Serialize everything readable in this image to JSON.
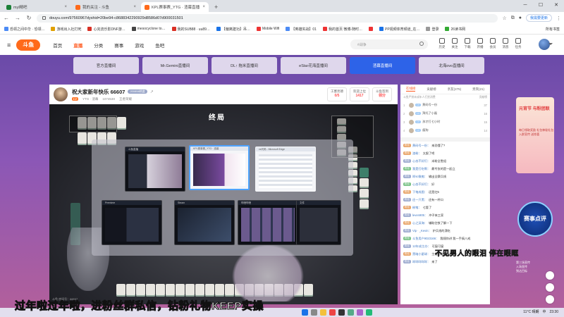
{
  "browser": {
    "tabs": [
      {
        "label": "myl精吧",
        "active": false,
        "color": "#1a7f37"
      },
      {
        "label": "我的关注 - 斗鱼",
        "active": false,
        "color": "#ff6a1a"
      },
      {
        "label": "KPL赛事赛_YTG · 渣幕直播",
        "active": true,
        "color": "#ff6a1a"
      }
    ],
    "new_tab": "+",
    "url": "douyu.com/97560967dyshid=20be94-c8688342290929d8586d07d900031501",
    "update_label": "我需要更新",
    "bookmarks": [
      {
        "label": "恐领之间中华 · 恐领…",
        "color": "#4c8bf5"
      },
      {
        "label": "游戏出入社打死",
        "color": "#e0a000"
      },
      {
        "label": "心完流乐影DNF游…",
        "color": "#d93025"
      },
      {
        "label": "mesocyclone to…",
        "color": "#444"
      },
      {
        "label": "我的SUB88 · uu89…",
        "color": "#d93025"
      },
      {
        "label": "【偏离建功】吊…",
        "color": "#1a73e8"
      },
      {
        "label": "Mobile Wifi",
        "color": "#e33"
      },
      {
        "label": "【英雄实战】01",
        "color": "#4c8bf5"
      },
      {
        "label": "我的首页 微博-随时…",
        "color": "#e33"
      },
      {
        "label": "",
        "color": "#e33"
      },
      {
        "label": "PP视频体育频道_在…",
        "color": "#1a73e8"
      },
      {
        "label": "登录",
        "color": "#999"
      },
      {
        "label": "26读书网",
        "color": "#3a3"
      }
    ],
    "all_bookmarks": "所有书签"
  },
  "douyu": {
    "logo": "斗鱼",
    "nav": [
      "首页",
      "直播",
      "分类",
      "赛事",
      "游戏",
      "鱼吧"
    ],
    "active_nav": "直播",
    "search_placeholder": "#战争",
    "header_icons": [
      {
        "name": "history-icon",
        "label": "历史"
      },
      {
        "name": "follow-icon",
        "label": "关注"
      },
      {
        "name": "download-icon",
        "label": "下载"
      },
      {
        "name": "broadcast-icon",
        "label": "开播"
      },
      {
        "name": "recharge-icon",
        "label": "会员"
      },
      {
        "name": "message-icon",
        "label": "消息"
      },
      {
        "name": "task-icon",
        "label": "任务"
      }
    ]
  },
  "related_rooms": [
    {
      "label": "官方直播间",
      "active": false
    },
    {
      "label": "Mr.Gemini直播间",
      "active": false
    },
    {
      "label": "DL↑ 拖米直播间",
      "active": false
    },
    {
      "label": "eStar花海直播间",
      "active": false
    },
    {
      "label": "渣幕直播间",
      "active": true
    },
    {
      "label": "北海ovo直播间",
      "active": false
    }
  ],
  "room": {
    "title": "祝大家新年快乐 66607",
    "heat_badge": "200858热度",
    "tag": "LV",
    "category": "YTG · 渣幕",
    "id": "1074530",
    "report": "王者荣耀",
    "stats": [
      {
        "label": "工塞亮德",
        "value": "0/5"
      },
      {
        "label": "欢迎上位",
        "value": "1417"
      },
      {
        "label": "斗鱼签到",
        "value": "领分"
      }
    ],
    "watermark": "斗鱼 房间号：66607"
  },
  "game": {
    "title": "终局",
    "windows": [
      {
        "label": "斗鱼直播",
        "theme": "dark"
      },
      {
        "label": "KPL赛事赛_YTG · 渣幕",
        "theme": "light"
      },
      {
        "label": "vs代码 - Microsoft Edge",
        "theme": "light"
      },
      {
        "label": "Premiere",
        "theme": "dark"
      },
      {
        "label": "Steam",
        "theme": "dark"
      },
      {
        "label": "哔哩哔哩",
        "theme": "dark"
      },
      {
        "label": "文件",
        "theme": "dark"
      }
    ]
  },
  "chat": {
    "tabs": [
      "在线榜",
      "贡献榜",
      "亲友(275)",
      "贵宾(21)"
    ],
    "rank_note": "斗鱼严禁未成年人打赏消费",
    "rank_more": "贡献榜",
    "ranking": [
      {
        "num": "1",
        "level": "LV",
        "name": "黄码号一份",
        "score": "37"
      },
      {
        "num": "2",
        "level": "LV",
        "name": "拜托了小磊",
        "score": "16"
      },
      {
        "num": "3",
        "level": "LV",
        "name": "孩才打七小时",
        "score": "15"
      },
      {
        "num": "4",
        "level": "LV",
        "name": "瘦狗",
        "score": "14"
      }
    ],
    "messages": [
      {
        "badge": "粉丝",
        "nick": "黄码号一份：",
        "text": "来恐懂了?"
      },
      {
        "badge": "粉丝",
        "nick": "渣粉：",
        "text": "太狠了吧"
      },
      {
        "badge": "粉丝",
        "nick": "心态不好们：",
        "text": "米粉全胜组"
      },
      {
        "badge": "粉丝",
        "nick": "我是打吃啊：",
        "text": "最专张的是一起立"
      },
      {
        "badge": "粉丝",
        "nick": "咩sc微痴：",
        "text": "输出全赛兵线"
      },
      {
        "badge": "粉丝",
        "nick": "心态不好们：",
        "text": "好"
      },
      {
        "badge": "粉丝",
        "nick": "下笔成图：",
        "text": "还是红5"
      },
      {
        "badge": "粉丝",
        "nick": "还一只黑：",
        "text": "还有一杯口"
      },
      {
        "badge": "粉丝",
        "nick": "粉笔：",
        "text": "七管了"
      },
      {
        "badge": "粉丝",
        "nick": "leven905：",
        "text": "冲子来三家"
      },
      {
        "badge": "粉丝",
        "nick": "心之深海：",
        "text": "辅助往铁了解一下"
      },
      {
        "badge": "粉丝",
        "nick": "Vip · _Kevin：",
        "text": "护兵线的漂吃"
      },
      {
        "badge": "粉丝",
        "nick": "斗鱼用户9023166：",
        "text": "我随你讲 我一手搞八戒"
      },
      {
        "badge": "粉丝",
        "nick": "12年成主办：",
        "text": "可窗可窗"
      },
      {
        "badge": "粉丝",
        "nick": "黑暗小星球：",
        "text": "主播超级黑。乱杀"
      },
      {
        "badge": "粉丝",
        "nick": "咩咩咩咩咩：",
        "text": "来了"
      }
    ]
  },
  "ads": {
    "top_title": "元宵节 与粉团联",
    "top_desc": "每日领取奖励 礼包神秘礼包 入群宣传 送惊喜",
    "event_label": "赛事点评",
    "bottom_lines": [
      "第三场宣传",
      "入场宣传",
      "到达目标"
    ]
  },
  "overlay": {
    "lyric": "不见男人的眼泪 停在眼眶",
    "caption": "过年啦过年啦，进粉丝群私信，钻粉礼物KEEP实操"
  },
  "taskbar": {
    "temp": "11°C 晴朗",
    "lang": "中",
    "time": "23:30"
  }
}
